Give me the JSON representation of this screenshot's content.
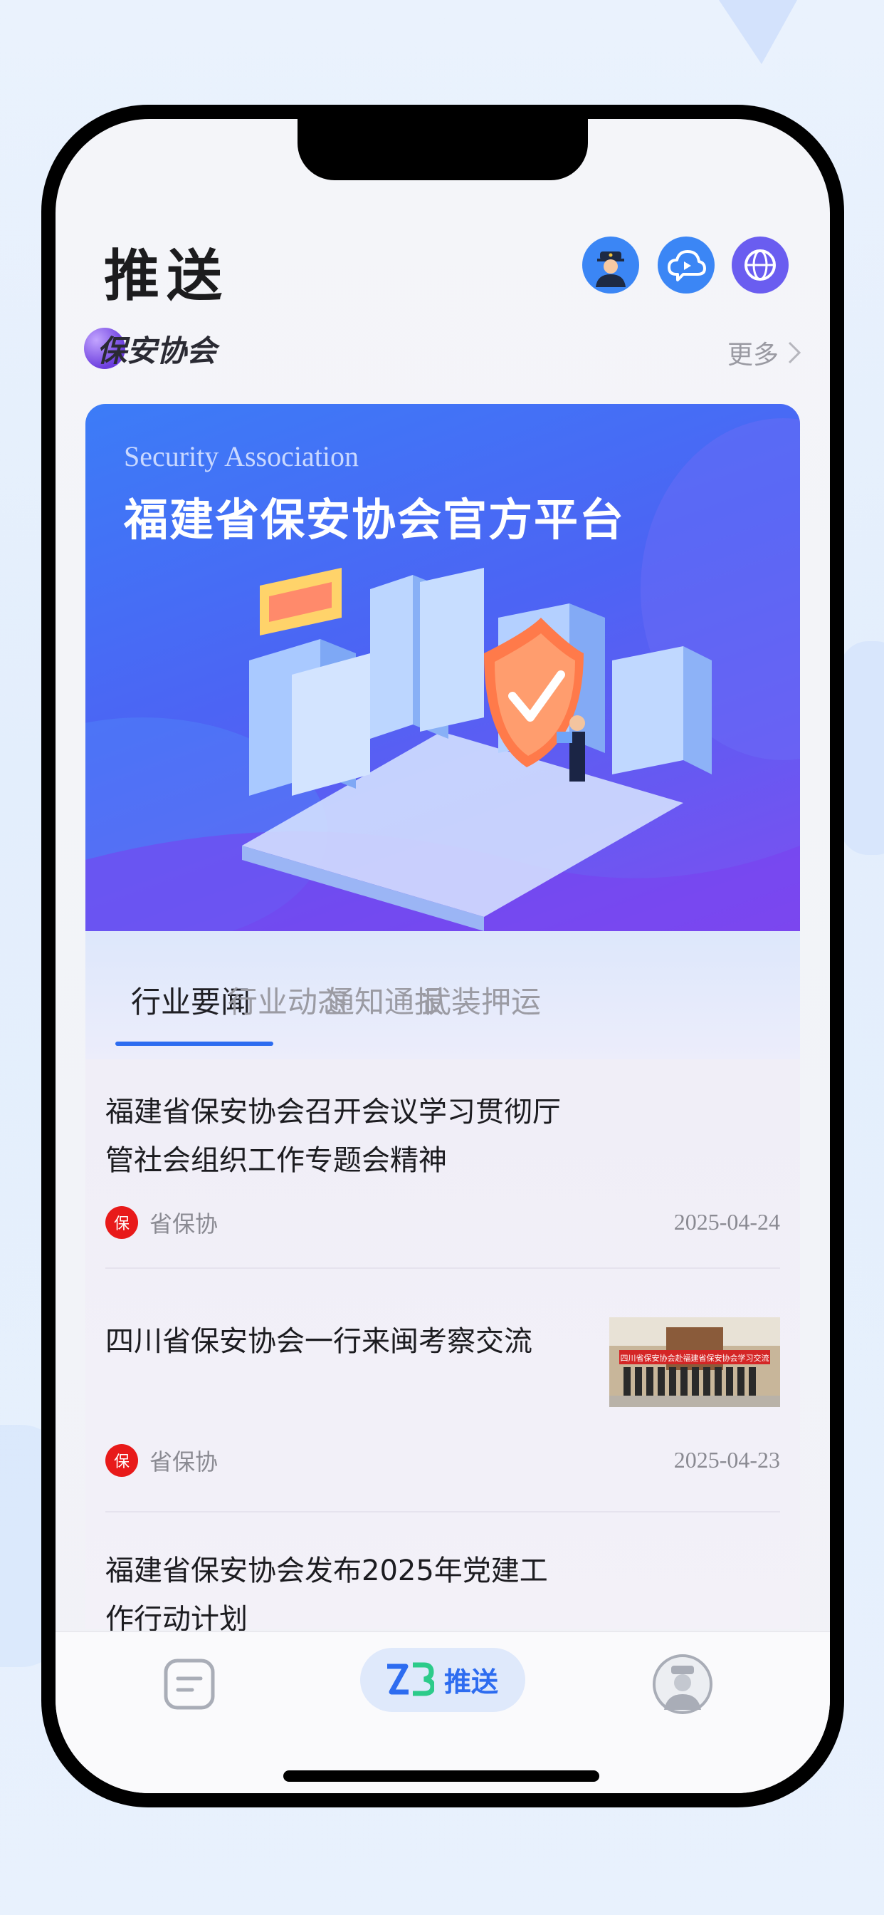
{
  "header": {
    "title": "推送"
  },
  "header_icons": [
    "police-avatar-icon",
    "cloud-chat-icon",
    "globe-icon"
  ],
  "section": {
    "brand": "保安协会",
    "more": "更多"
  },
  "banner": {
    "subtitle": "Security Association",
    "title": "福建省保安协会官方平台"
  },
  "tabs": [
    {
      "label": "行业要闻",
      "active": true
    },
    {
      "label": "行业动态",
      "active": false
    },
    {
      "label": "通知通报",
      "active": false
    },
    {
      "label": "武装押运",
      "active": false
    }
  ],
  "news": [
    {
      "title": "福建省保安协会召开会议学习贯彻厅管社会组织工作专题会精神",
      "badge": "保",
      "source": "省保协",
      "date": "2025-04-24"
    },
    {
      "title": "四川省保安协会一行来闽考察交流",
      "badge": "保",
      "source": "省保协",
      "date": "2025-04-23",
      "thumb_banner": "四川省保安协会赴福建省保安协会学习交流"
    },
    {
      "title": "福建省保安协会发布2025年党建工作行动计划"
    }
  ],
  "tabbar": {
    "push_label": "推送",
    "push_logo": "ZB"
  },
  "colors": {
    "accent": "#2d6cf0",
    "badge": "#e81a1a"
  }
}
